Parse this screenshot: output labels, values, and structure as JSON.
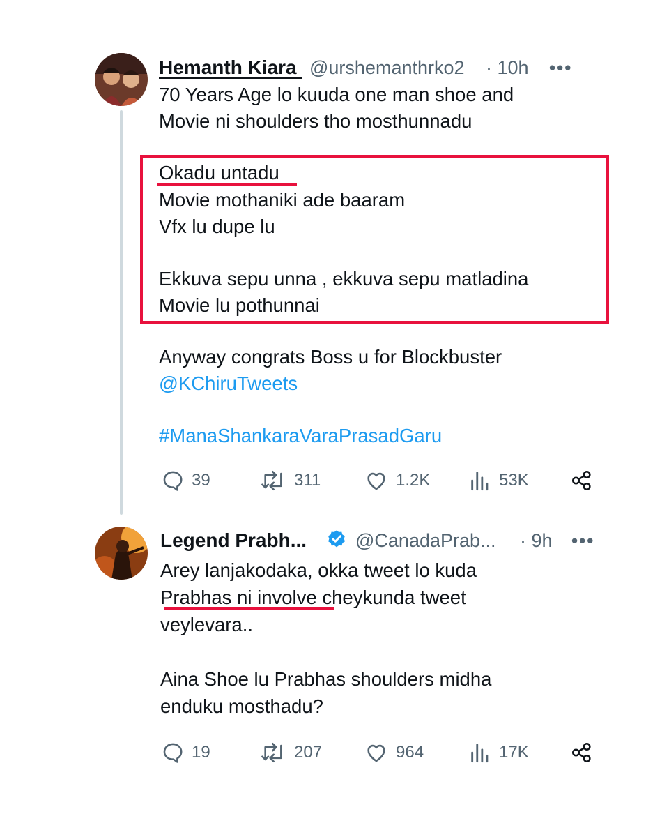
{
  "tweet1": {
    "name": "Hemanth Kiara",
    "handle": "@urshemanthrko2",
    "time": "· 10h",
    "more": "•••",
    "lines": [
      "70 Years Age lo kuuda one man shoe and",
      "Movie ni shoulders tho mosthunnadu",
      "Okadu untadu",
      "Movie mothaniki ade baaram",
      "Vfx lu dupe lu",
      "Ekkuva sepu unna , ekkuva sepu matladina",
      "Movie lu pothunnai",
      "Anyway congrats Boss u for Blockbuster"
    ],
    "mention": "@KChiruTweets",
    "hashtag": "#ManaShankaraVaraPrasadGaru",
    "stats": {
      "replies": "39",
      "reposts": "311",
      "likes": "1.2K",
      "views": "53K"
    }
  },
  "tweet2": {
    "name": "Legend Prabh...",
    "handle": "@CanadaPrab...",
    "time": "· 9h",
    "more": "•••",
    "lines": [
      "Arey lanjakodaka, okka tweet lo kuda",
      "Prabhas ni involve cheykunda tweet",
      "veylevara..",
      "Aina Shoe lu Prabhas shoulders midha",
      "enduku mosthadu?"
    ],
    "stats": {
      "replies": "19",
      "reposts": "207",
      "likes": "964",
      "views": "17K"
    }
  },
  "colors": {
    "highlight_red": "#e8113d",
    "link_blue": "#1d9bf0",
    "muted_gray": "#536471",
    "verified_blue": "#1d9bf0"
  },
  "icons": [
    "reply-icon",
    "repost-icon",
    "like-icon",
    "views-icon",
    "share-icon",
    "verified-badge-icon",
    "more-icon"
  ]
}
